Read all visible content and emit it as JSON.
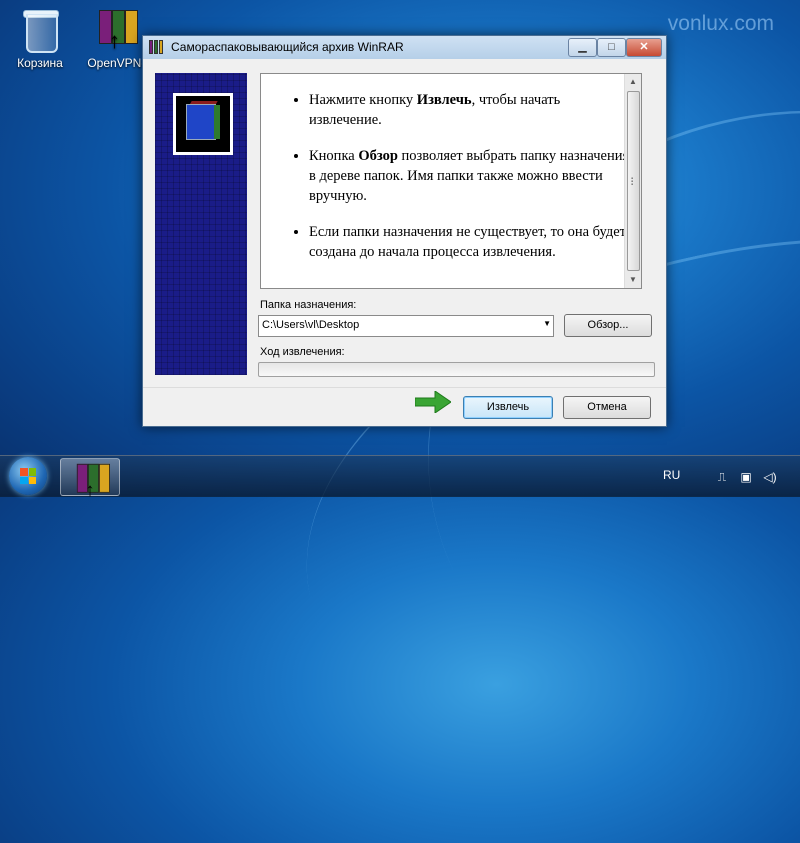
{
  "watermark": "vonlux.com",
  "desktop": {
    "icons": [
      {
        "label": "Корзина",
        "icon": "recycle-bin-icon"
      },
      {
        "label": "OpenVPN-I",
        "icon": "winrar-archive-icon"
      }
    ]
  },
  "dialog": {
    "title": "Самораспаковывающийся архив WinRAR",
    "controls": {
      "minimize": "▁",
      "maximize": "□",
      "close": "✕"
    },
    "instructions": [
      {
        "pre": "Нажмите кнопку ",
        "bold": "Извлечь",
        "post": ", чтобы начать извлечение."
      },
      {
        "pre": "Кнопка ",
        "bold": "Обзор",
        "post": " позволяет выбрать папку назначения в дереве папок. Имя папки также можно ввести вручную."
      },
      {
        "pre": "",
        "bold": "",
        "post": "Если папки назначения не существует, то она будет создана до начала процесса извлечения."
      }
    ],
    "destination_label": "Папка назначения:",
    "destination_value": "C:\\Users\\vl\\Desktop",
    "browse_button": "Обзор...",
    "progress_label": "Ход извлечения:",
    "progress_value": 0,
    "extract_button": "Извлечь",
    "cancel_button": "Отмена"
  },
  "taskbar": {
    "language": "RU",
    "tray_icons": [
      "usb-icon",
      "network-icon",
      "volume-icon"
    ]
  },
  "colors": {
    "accent_arrow": "#3aa534",
    "banner": "#1a1c88"
  }
}
